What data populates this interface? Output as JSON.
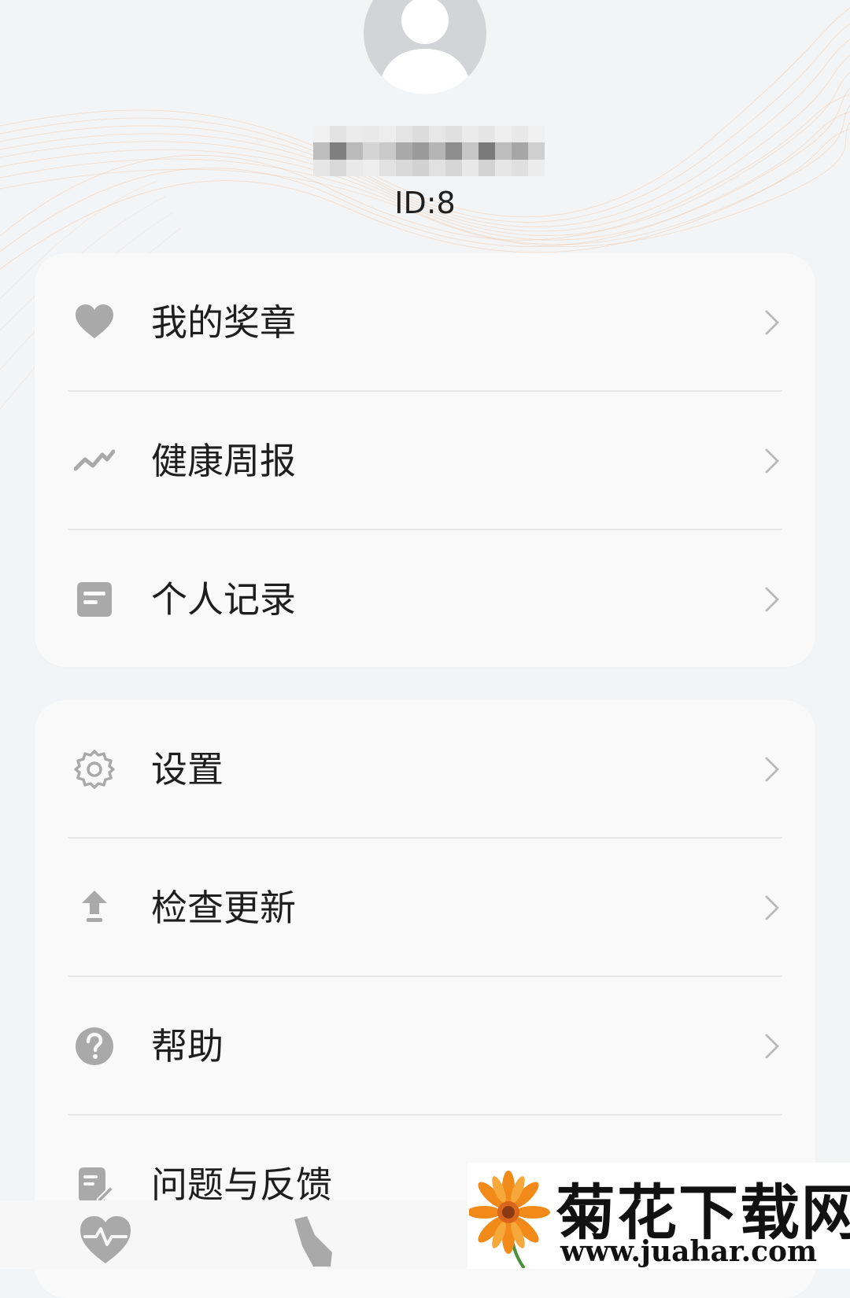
{
  "profile": {
    "user_id": "ID:8"
  },
  "menu_primary": [
    {
      "label": "我的奖章",
      "icon": "heart-icon"
    },
    {
      "label": "健康周报",
      "icon": "trend-line-icon"
    },
    {
      "label": "个人记录",
      "icon": "document-icon"
    }
  ],
  "menu_secondary": [
    {
      "label": "设置",
      "icon": "gear-icon"
    },
    {
      "label": "检查更新",
      "icon": "upload-arrow-icon"
    },
    {
      "label": "帮助",
      "icon": "question-icon"
    },
    {
      "label": "问题与反馈",
      "icon": "feedback-edit-icon"
    }
  ],
  "bottom_nav": [
    {
      "icon": "heart-pulse-icon"
    },
    {
      "icon": "shoe-icon"
    }
  ],
  "watermark": {
    "title": "菊花下载网",
    "url": "www.juahar.com"
  },
  "colors": {
    "page_bg": "#f3f4f6",
    "card_bg": "#f9f9f9",
    "icon_gray": "#a9a9a9",
    "chevron_gray": "#bcbcbc",
    "wave_accent": "#f2c7a4"
  }
}
